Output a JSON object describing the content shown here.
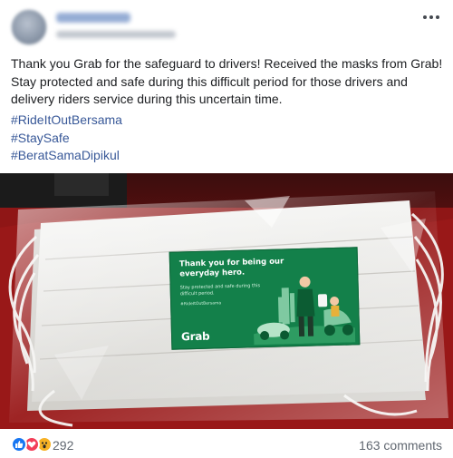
{
  "post": {
    "text": "Thank you Grab for the safeguard to drivers! Received the masks from Grab! Stay protected and safe during this difficult period for those drivers and delivery riders service during this uncertain time.",
    "hashtags": [
      "#RideItOutBersama",
      "#StaySafe",
      "#BeratSamaDipikul"
    ]
  },
  "photo": {
    "card_title": "Thank you for being our everyday hero.",
    "card_subtitle": "Stay protected and safe during this difficult period.",
    "card_tag": "#RideItOutBersama",
    "card_logo": "Grab"
  },
  "reactions": {
    "icons": [
      "like-icon",
      "love-icon",
      "wow-icon"
    ],
    "count": "292",
    "comments": "163 comments"
  },
  "colors": {
    "link": "#385898",
    "grab_green": "#13804a",
    "like": "#1877f2",
    "love": "#f33e58",
    "wow": "#f7b125"
  }
}
